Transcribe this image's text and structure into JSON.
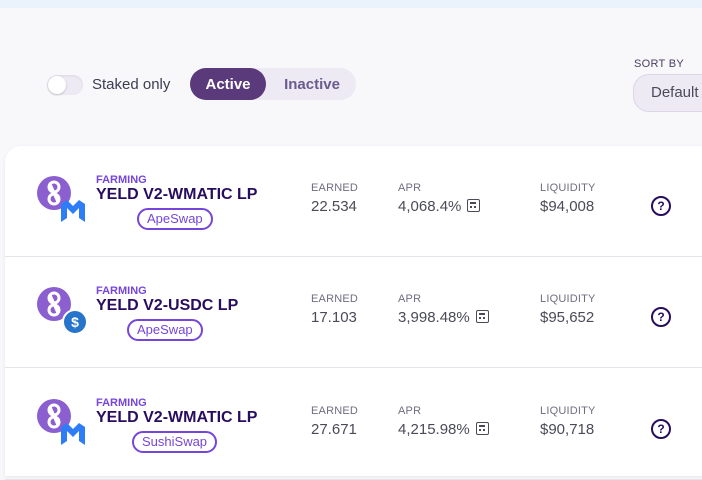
{
  "filters": {
    "staked_only_label": "Staked only",
    "tabs": {
      "active": "Active",
      "inactive": "Inactive"
    },
    "sort": {
      "label": "SORT BY",
      "value": "Default"
    }
  },
  "headers": {
    "earned": "EARNED",
    "apr": "APR",
    "liquidity": "LIQUIDITY"
  },
  "farms": [
    {
      "tag": "FARMING",
      "pair": "YELD V2-WMATIC LP",
      "exchange": "ApeSwap",
      "earned": "22.534",
      "apr": "4,068.4%",
      "liquidity": "$94,008",
      "quote_token": "wmatic-icon"
    },
    {
      "tag": "FARMING",
      "pair": "YELD V2-USDC LP",
      "exchange": "ApeSwap",
      "earned": "17.103",
      "apr": "3,998.48%",
      "liquidity": "$95,652",
      "quote_token": "usdc-icon"
    },
    {
      "tag": "FARMING",
      "pair": "YELD V2-WMATIC LP",
      "exchange": "SushiSwap",
      "earned": "27.671",
      "apr": "4,215.98%",
      "liquidity": "$90,718",
      "quote_token": "wmatic-icon"
    }
  ],
  "help_glyph": "?",
  "usdc_glyph": "$",
  "colors": {
    "primary": "#280d5f",
    "accent": "#7645d9",
    "active_tab": "#5b3a7c"
  }
}
